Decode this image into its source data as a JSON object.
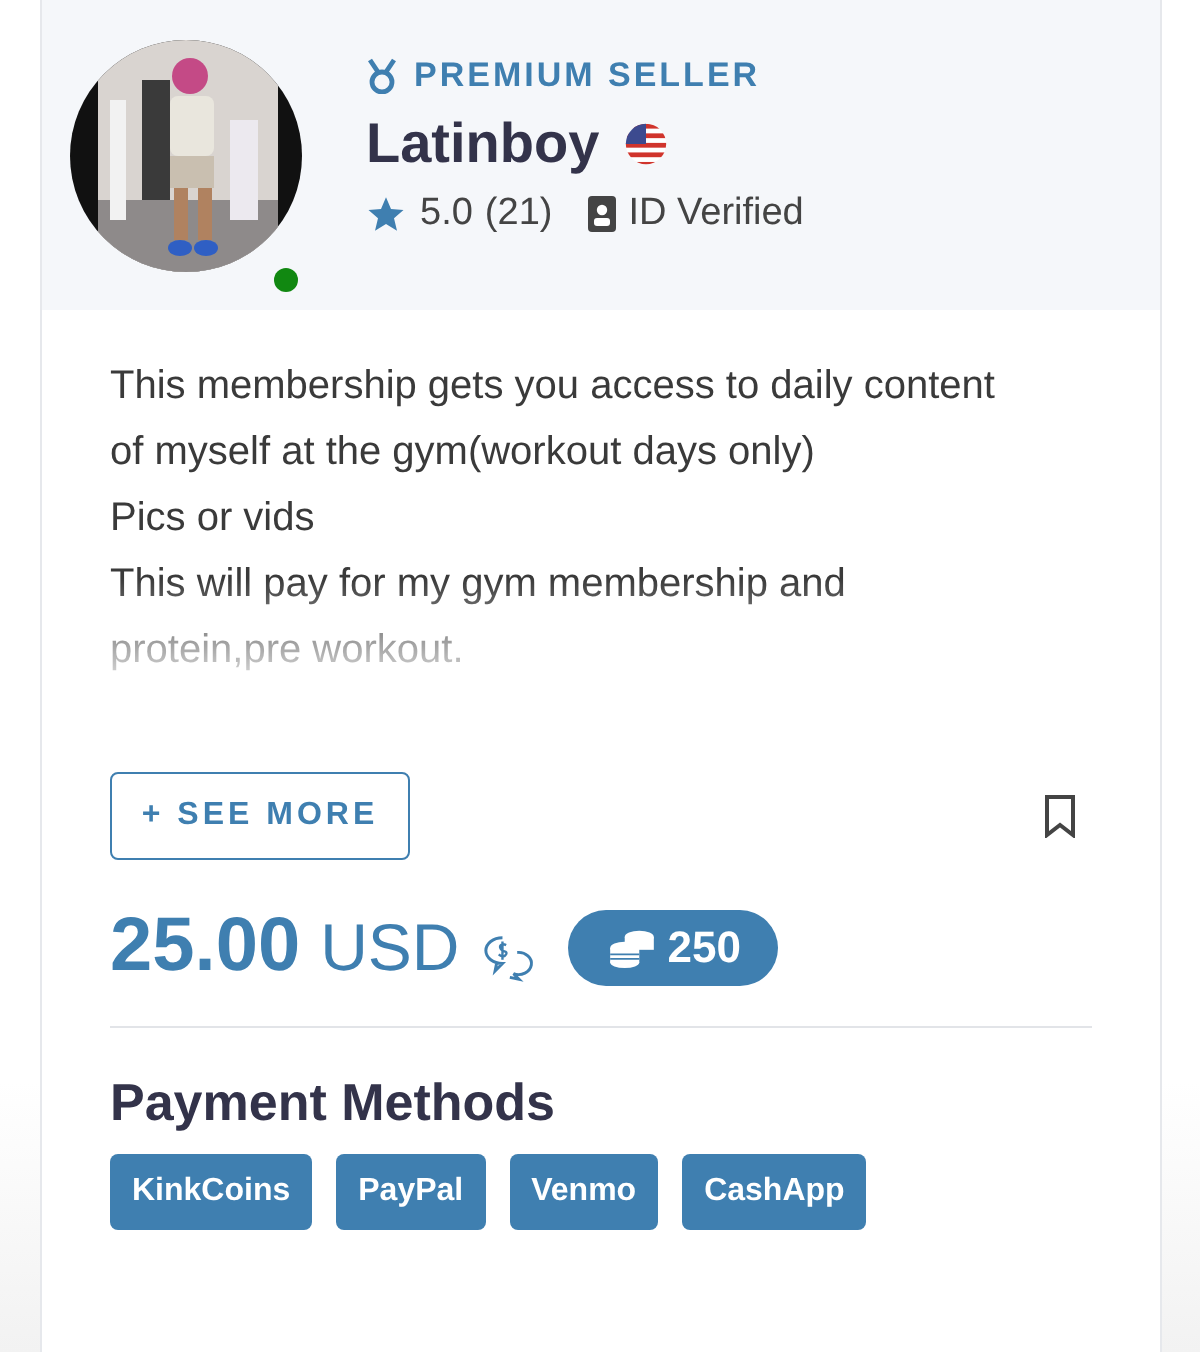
{
  "seller": {
    "badge": "PREMIUM SELLER",
    "name": "Latinboy",
    "rating": "5.0",
    "reviews": "(21)",
    "verification": "ID Verified",
    "online": true
  },
  "description": [
    "This membership gets you access to daily content of myself at the gym(workout days only)",
    "Pics or vids",
    "This will pay for my gym membership and protein,pre workout."
  ],
  "see_more": "+ SEE MORE",
  "bookmarked": false,
  "price": {
    "amount": "25.00",
    "currency": "USD",
    "coins": "250"
  },
  "payment_methods": {
    "title": "Payment Methods",
    "items": [
      "KinkCoins",
      "PayPal",
      "Venmo",
      "CashApp"
    ]
  }
}
